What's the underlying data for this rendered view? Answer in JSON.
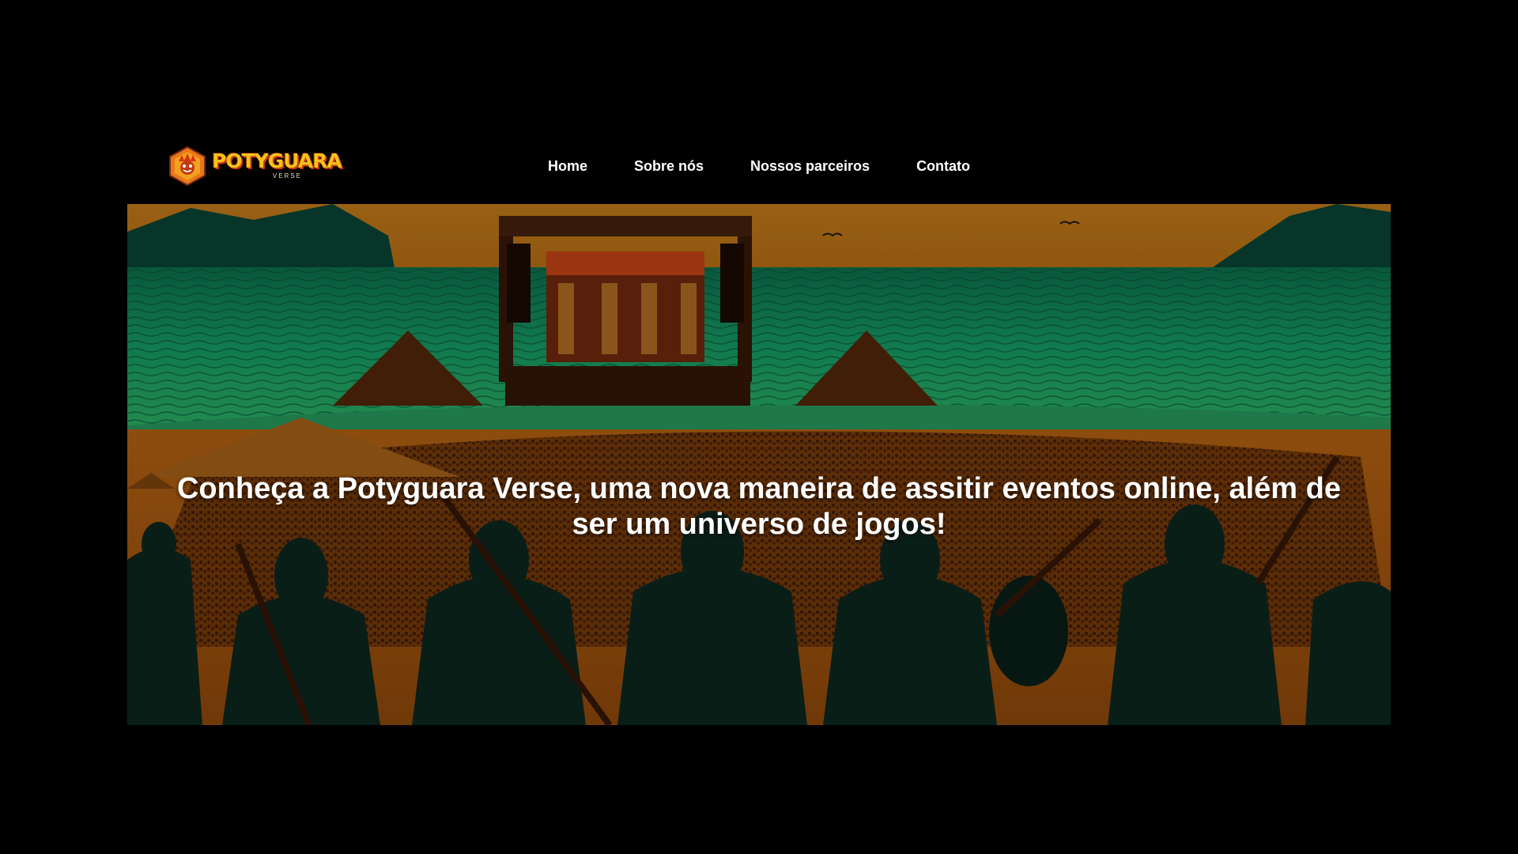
{
  "brand": {
    "logo_word": "POTYGUARA",
    "logo_sub": "VERSE",
    "logo_icon": "mascot-hexagon-icon",
    "colors": {
      "primary": "#f7c21a",
      "accent": "#c73414"
    }
  },
  "nav": {
    "items": [
      {
        "label": "Home"
      },
      {
        "label": "Sobre nós"
      },
      {
        "label": "Nossos parceiros"
      },
      {
        "label": "Contato"
      }
    ]
  },
  "hero": {
    "heading": "Conheça a Potyguara Verse, uma nova maneira de assitir eventos online, além de ser um universo de jogos!",
    "image": "beach-concert-warriors-illustration",
    "colors": {
      "sea": "#14a46a",
      "sand": "#c96a12",
      "sky": "#d0841c"
    }
  }
}
